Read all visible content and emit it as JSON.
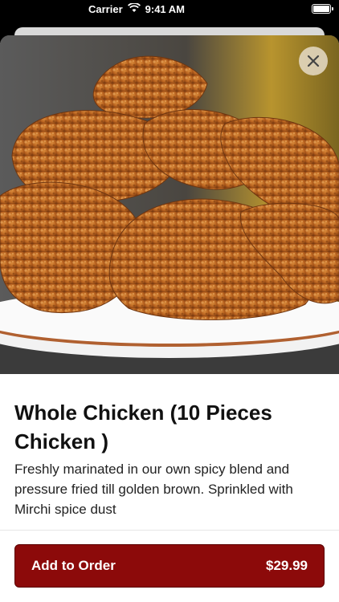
{
  "status_bar": {
    "carrier": "Carrier",
    "time": "9:41 AM",
    "wifi_icon": "wifi-icon",
    "battery_icon": "battery-icon"
  },
  "product": {
    "image_alt": "Fried chicken pieces on a plate",
    "title": "Whole Chicken (10 Pieces Chicken )",
    "description": "Freshly marinated in our own spicy blend and pressure fried till golden brown. Sprinkled with Mirchi spice dust"
  },
  "actions": {
    "close_icon": "close-icon",
    "add_label": "Add to Order",
    "price": "$29.99"
  },
  "colors": {
    "accent": "#8c0a0a",
    "close_bg": "#e6dcc8"
  }
}
